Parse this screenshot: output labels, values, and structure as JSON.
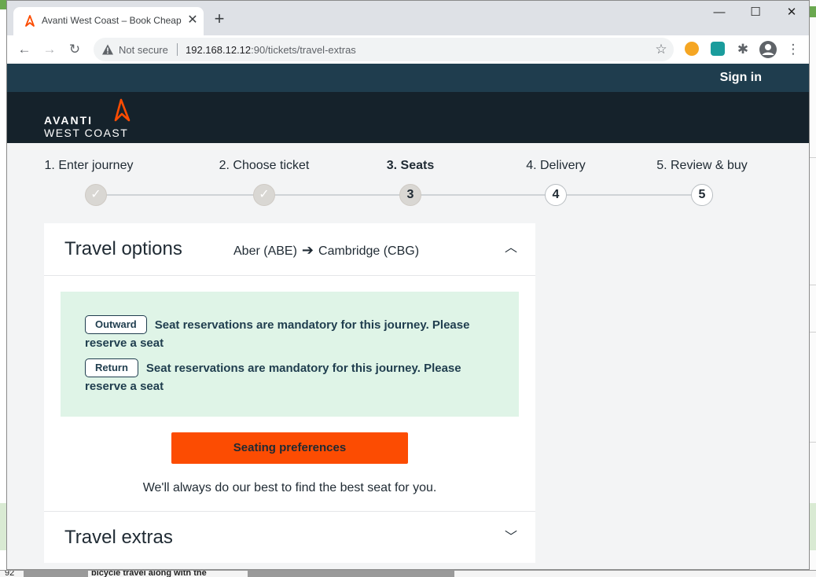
{
  "browser": {
    "tab_title": "Avanti West Coast – Book Cheap",
    "security_label": "Not secure",
    "url_host": "192.168.12.12",
    "url_path": ":90/tickets/travel-extras",
    "tab_close_glyph": "✕",
    "new_tab_glyph": "+",
    "minimize_glyph": "—",
    "maximize_glyph": "☐",
    "close_glyph": "✕",
    "back_glyph": "←",
    "forward_glyph": "→",
    "reload_glyph": "↻",
    "bookmark_glyph": "☆",
    "menu_glyph": "⋮",
    "extensions_glyph": "✱"
  },
  "site": {
    "sign_in": "Sign in",
    "logo_line1": "AVANTI",
    "logo_line2": "WEST COAST",
    "brand_color": "#fc4c02",
    "header_color": "#15222b",
    "topbar_color": "#1f3d4e"
  },
  "steps": [
    {
      "label": "1. Enter journey",
      "marker": "✓",
      "state": "done"
    },
    {
      "label": "2. Choose ticket",
      "marker": "✓",
      "state": "done"
    },
    {
      "label": "3. Seats",
      "marker": "3",
      "state": "current"
    },
    {
      "label": "4. Delivery",
      "marker": "4",
      "state": "todo"
    },
    {
      "label": "5. Review & buy",
      "marker": "5",
      "state": "todo"
    }
  ],
  "travel_options": {
    "title": "Travel options",
    "from": "Aber (ABE)",
    "arrow": "➔",
    "to": "Cambridge (CBG)",
    "collapse_glyph": "︿",
    "notices": [
      {
        "tag": "Outward",
        "message": "Seat reservations are mandatory for this journey. Please reserve a seat"
      },
      {
        "tag": "Return",
        "message": "Seat reservations are mandatory for this journey. Please reserve a seat"
      }
    ],
    "button": "Seating preferences",
    "hint": "We'll always do our best to find the best seat for you."
  },
  "travel_extras": {
    "title": "Travel extras",
    "expand_glyph": "﹀"
  },
  "background": {
    "row_number": "92",
    "cell_text": "bicycle travel along with the"
  }
}
